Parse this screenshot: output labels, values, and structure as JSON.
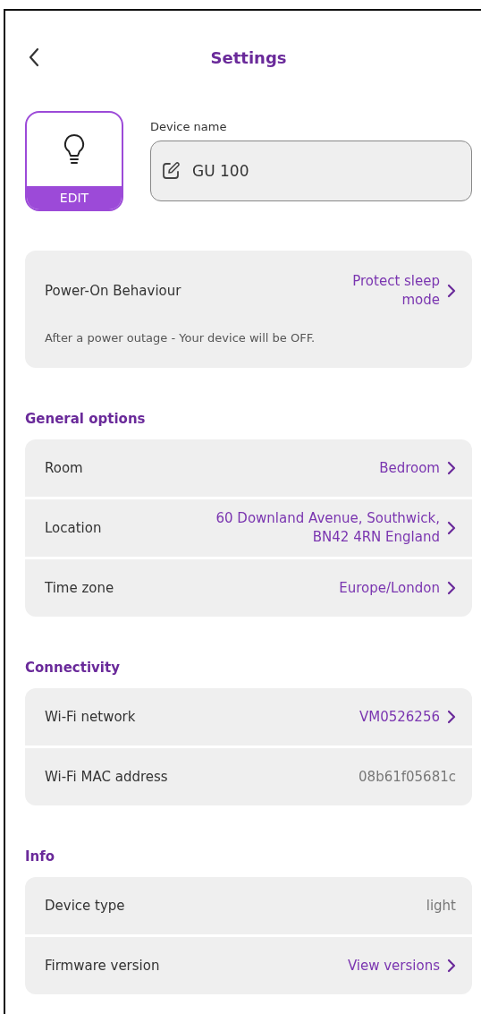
{
  "header": {
    "title": "Settings"
  },
  "device": {
    "edit_label": "EDIT",
    "name_label": "Device name",
    "name_value": "GU 100"
  },
  "power_on": {
    "label": "Power-On Behaviour",
    "value": "Protect sleep mode",
    "note": "After a power outage - Your device will be OFF."
  },
  "sections": [
    {
      "title": "General options",
      "rows": [
        {
          "kind": "link",
          "label": "Room",
          "value": "Bedroom"
        },
        {
          "kind": "link",
          "label": "Location",
          "value": "60 Downland Avenue, Southwick, BN42 4RN England"
        },
        {
          "kind": "link",
          "label": "Time zone",
          "value": "Europe/London"
        }
      ]
    },
    {
      "title": "Connectivity",
      "rows": [
        {
          "kind": "link",
          "label": "Wi-Fi network",
          "value": "VM0526256"
        },
        {
          "kind": "static",
          "label": "Wi-Fi MAC address",
          "value": "08b61f05681c"
        }
      ]
    },
    {
      "title": "Info",
      "rows": [
        {
          "kind": "static",
          "label": "Device type",
          "value": "light"
        },
        {
          "kind": "link",
          "label": "Firmware version",
          "value": "View versions"
        }
      ]
    }
  ]
}
